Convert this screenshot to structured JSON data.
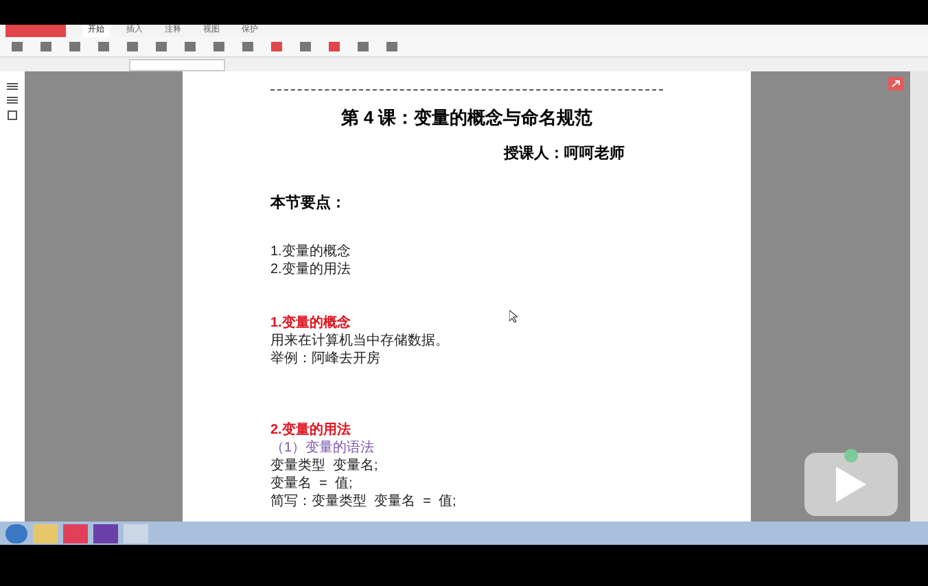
{
  "menu_tabs": [
    {
      "label": "开始",
      "selected": true
    },
    {
      "label": "插入",
      "selected": false
    },
    {
      "label": "注释",
      "selected": false
    },
    {
      "label": "视图",
      "selected": false
    },
    {
      "label": "保护",
      "selected": false
    }
  ],
  "document": {
    "title": "第 4 课：变量的概念与命名规范",
    "author": "授课人：呵呵老师",
    "lines": [
      {
        "kind": "heading",
        "text": "本节要点："
      },
      {
        "kind": "gap"
      },
      {
        "kind": "plain",
        "text": "1.变量的概念"
      },
      {
        "kind": "plain",
        "text": "2.变量的用法"
      },
      {
        "kind": "gap"
      },
      {
        "kind": "gap"
      },
      {
        "kind": "red",
        "text": "1.变量的概念"
      },
      {
        "kind": "plain",
        "text": "用来在计算机当中存储数据。"
      },
      {
        "kind": "plain",
        "text": "举例：阿峰去开房"
      },
      {
        "kind": "gap"
      },
      {
        "kind": "gap"
      },
      {
        "kind": "gap"
      },
      {
        "kind": "red",
        "text": "2.变量的用法"
      },
      {
        "kind": "purple",
        "text": "（1）变量的语法"
      },
      {
        "kind": "plain",
        "text": "变量类型  变量名;"
      },
      {
        "kind": "plain",
        "text": "变量名  =  值;"
      },
      {
        "kind": "plain",
        "text": "简写：变量类型  变量名  =  值;"
      }
    ]
  }
}
